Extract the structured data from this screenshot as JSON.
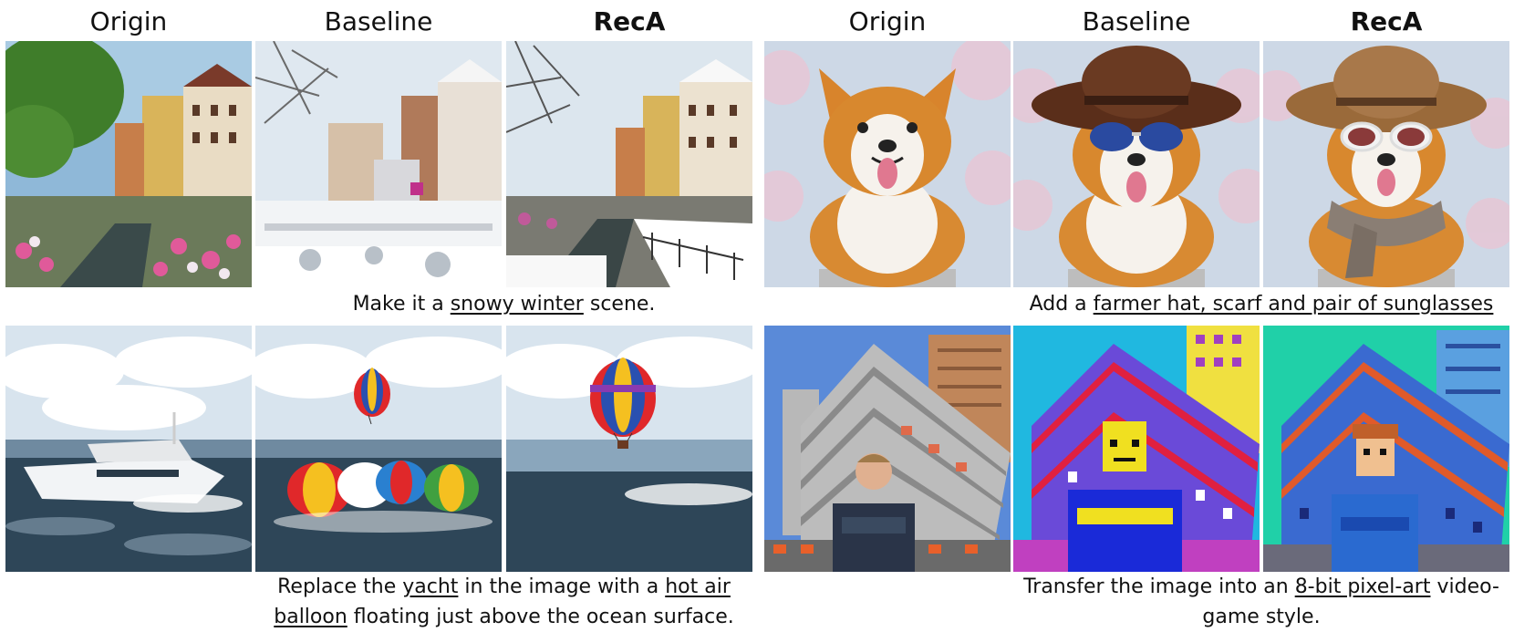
{
  "headers": [
    "Origin",
    "Baseline",
    "RecA",
    "Origin",
    "Baseline",
    "RecA"
  ],
  "captions": {
    "snow": {
      "pre": "Make it a ",
      "u1": "snowy winter",
      "post": " scene."
    },
    "hat": {
      "pre": "Add a ",
      "u1": "farmer hat, scarf and pair of sunglasses"
    },
    "balloon": {
      "pre": "Replace the ",
      "u1": "yacht",
      "mid": " in the image with a ",
      "u2": "hot air",
      "u3": "balloon",
      "post": " floating just above the ocean surface."
    },
    "pixel": {
      "pre": "Transfer the image into an ",
      "u1": "8-bit pixel-art",
      "post": " video-",
      "line2": "game style."
    }
  }
}
